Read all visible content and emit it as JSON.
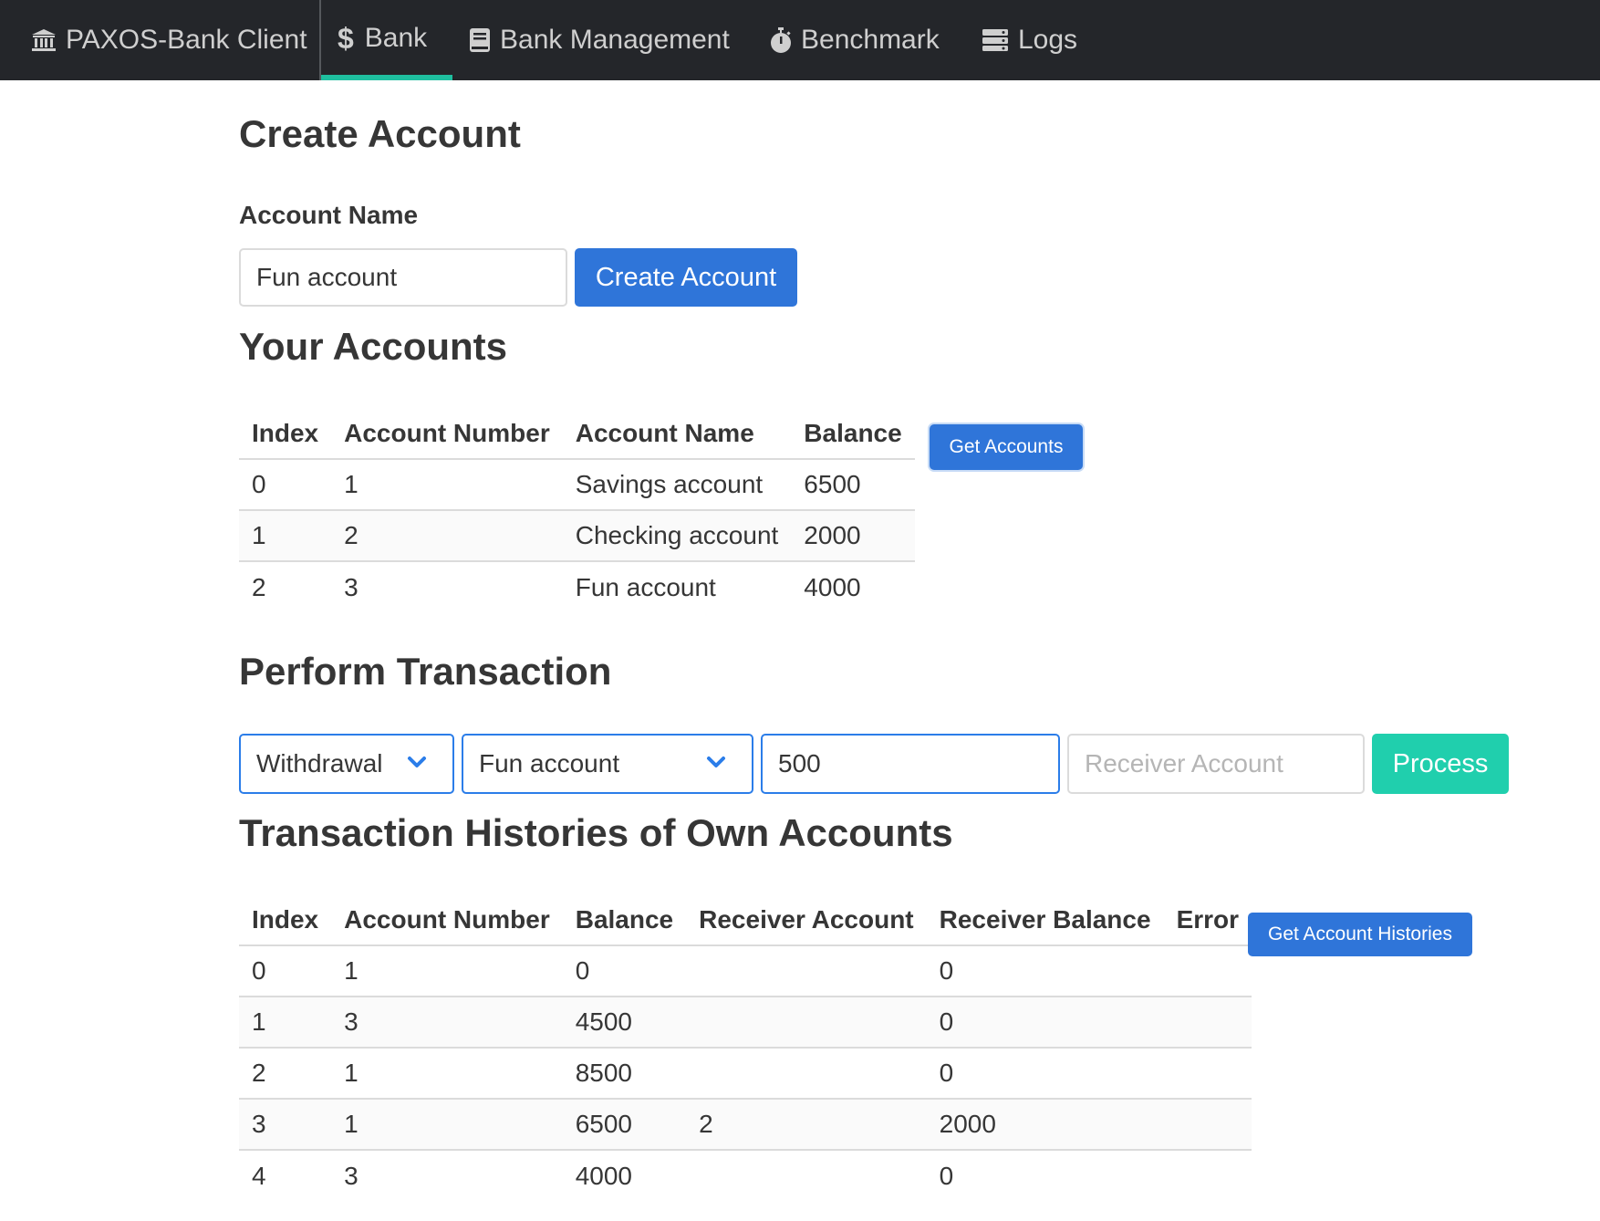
{
  "nav": {
    "brand": "PAXOS-Bank Client",
    "bank": "Bank",
    "management": "Bank Management",
    "benchmark": "Benchmark",
    "logs": "Logs",
    "dollar_glyph": "$",
    "icons": [
      "bank-icon",
      "book-icon",
      "stopwatch-icon",
      "server-icon"
    ],
    "active_underline_color": "#1fbf9f"
  },
  "create": {
    "title": "Create Account",
    "name_label": "Account Name",
    "name_value": "Fun account",
    "button": "Create Account"
  },
  "accounts": {
    "title": "Your Accounts",
    "headers": [
      "Index",
      "Account Number",
      "Account Name",
      "Balance"
    ],
    "rows": [
      [
        "0",
        "1",
        "Savings account",
        "6500"
      ],
      [
        "1",
        "2",
        "Checking account",
        "2000"
      ],
      [
        "2",
        "3",
        "Fun account",
        "4000"
      ]
    ],
    "button": "Get Accounts"
  },
  "transaction": {
    "title": "Perform Transaction",
    "type_selected": "Withdrawal",
    "account_selected": "Fun account",
    "amount_value": "500",
    "receiver_placeholder": "Receiver Account",
    "button": "Process"
  },
  "histories": {
    "title": "Transaction Histories of Own Accounts",
    "headers": [
      "Index",
      "Account Number",
      "Balance",
      "Receiver Account",
      "Receiver Balance",
      "Error"
    ],
    "rows": [
      [
        "0",
        "1",
        "0",
        "",
        "0",
        ""
      ],
      [
        "1",
        "3",
        "4500",
        "",
        "0",
        ""
      ],
      [
        "2",
        "1",
        "8500",
        "",
        "0",
        ""
      ],
      [
        "3",
        "1",
        "6500",
        "2",
        "2000",
        ""
      ],
      [
        "4",
        "3",
        "4000",
        "",
        "0",
        ""
      ]
    ],
    "button": "Get Account Histories"
  },
  "colors": {
    "navbar": "#24262a",
    "primary": "#2f75d9",
    "success": "#20cfad",
    "focus_border": "#2b7de9"
  }
}
